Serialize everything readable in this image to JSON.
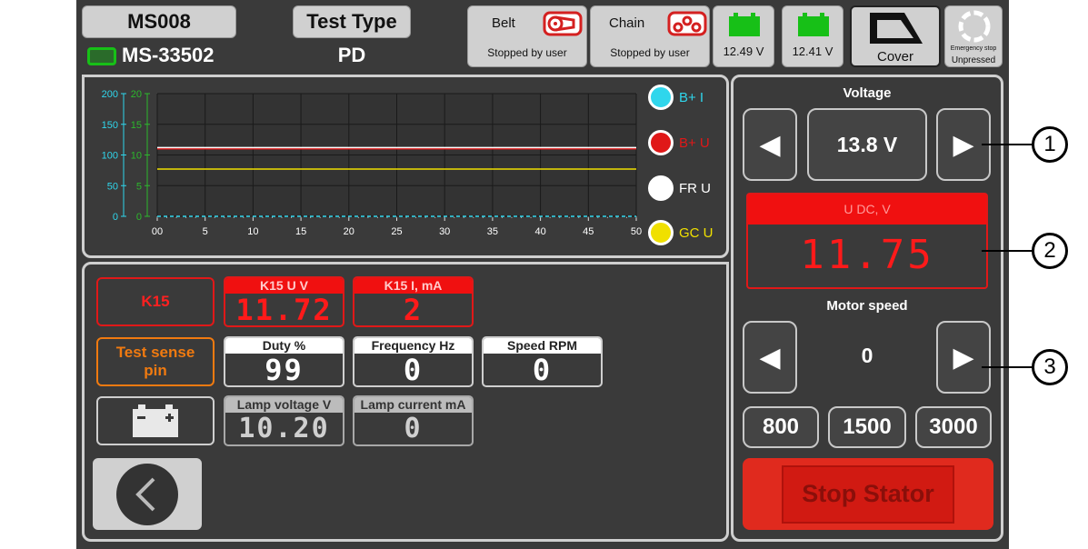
{
  "header": {
    "device_id": "MS008",
    "serial": "MS-33502",
    "test_type_label": "Test Type",
    "test_type_value": "PD",
    "belt": {
      "label": "Belt",
      "status": "Stopped by user"
    },
    "chain": {
      "label": "Chain",
      "status": "Stopped by user"
    },
    "battery1": "12.49 V",
    "battery2": "12.41 V",
    "cover": "Cover",
    "estop": {
      "label": "Emergency stop",
      "status": "Unpressed"
    }
  },
  "chart_data": {
    "type": "line",
    "x_ticks": [
      "00",
      "5",
      "10",
      "15",
      "20",
      "25",
      "30",
      "35",
      "40",
      "45",
      "50"
    ],
    "xlim": [
      0,
      50
    ],
    "y_left_ticks": [
      "200",
      "150",
      "100",
      "50",
      "0"
    ],
    "y_left_range": [
      0,
      200
    ],
    "y_right_ticks": [
      "20",
      "15",
      "10",
      "5",
      "0"
    ],
    "y_right_range": [
      0,
      20
    ],
    "grid": true,
    "series": [
      {
        "name": "B+ I",
        "color": "#2fd6ec",
        "axis": "left",
        "values": [
          0,
          0
        ]
      },
      {
        "name": "B+ U",
        "color": "#e01818",
        "axis": "right",
        "values": [
          11.0,
          11.0
        ]
      },
      {
        "name": "FR U",
        "color": "#ffffff",
        "axis": "right",
        "values": [
          11.2,
          11.2
        ]
      },
      {
        "name": "GC U",
        "color": "#f0e000",
        "axis": "right",
        "values": [
          7.7,
          7.7
        ]
      }
    ],
    "legend_colors": {
      "b_i": "#2fd6ec",
      "b_u": "#e01818",
      "fr_u": "#ffffff",
      "gc_u": "#f0e000"
    }
  },
  "left": {
    "k15": "K15",
    "test_sense": "Test sense pin",
    "battery_icon": "battery-icon",
    "displays": {
      "k15_u": {
        "label": "K15 U V",
        "value": "11.72"
      },
      "k15_i": {
        "label": "K15 I, mA",
        "value": "2"
      },
      "duty": {
        "label": "Duty %",
        "value": "99"
      },
      "freq": {
        "label": "Frequency Hz",
        "value": "0"
      },
      "speed": {
        "label": "Speed RPM",
        "value": "0"
      },
      "lamp_v": {
        "label": "Lamp voltage V",
        "value": "10.20"
      },
      "lamp_i": {
        "label": "Lamp current mA",
        "value": "0"
      }
    }
  },
  "right": {
    "voltage_label": "Voltage",
    "voltage_value": "13.8 V",
    "udc_label": "U DC, V",
    "udc_value": "11.75",
    "motor_speed_label": "Motor speed",
    "motor_speed_value": "0",
    "presets": [
      "800",
      "1500",
      "3000"
    ],
    "stop_stator": "Stop Stator"
  },
  "callouts": [
    "1",
    "2",
    "3"
  ]
}
